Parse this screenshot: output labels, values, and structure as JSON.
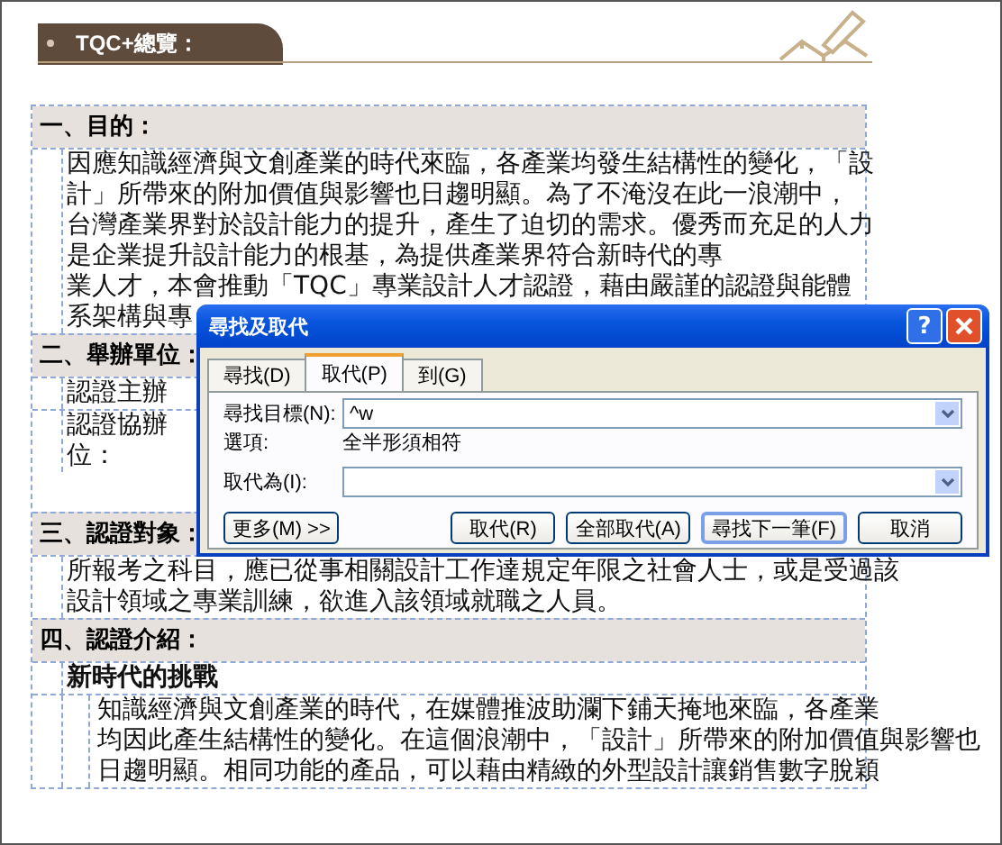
{
  "header": {
    "title": "TQC+總覽："
  },
  "sections": [
    {
      "heading": "一、目的：",
      "rows": [
        {
          "kind": "text",
          "lines": [
            "因應知識經濟與文創產業的時代來臨，各產業均發生結構性的變化，「設",
            "計」所帶來的附加價值與影響也日趨明顯。為了不淹沒在此一浪潮中，",
            "台灣產業界對於設計能力的提升，產生了迫切的需求。優秀而充足的人力",
            "是企業提升設計能力的根基，為提供產業界符合新時代的專",
            "業人才，本會推動「TQC」專業設計人才認證，藉由嚴謹的認證與能體",
            "系架構與專"
          ]
        }
      ]
    },
    {
      "heading": "二、舉辦單位：",
      "rows": [
        {
          "kind": "text",
          "lines": [
            "認證主辦"
          ]
        },
        {
          "kind": "text",
          "lines": [
            "認證協辦",
            "位："
          ]
        }
      ]
    },
    {
      "heading": "三、認證對象：",
      "rows": [
        {
          "kind": "text",
          "lines": [
            "所報考之科目，應已從事相關設計工作達規定年限之社會人士，或是受過該",
            "設計領域之專業訓練，欲進入該領域就職之人員。"
          ]
        }
      ]
    },
    {
      "heading": "四、認證介紹：",
      "rows": [
        {
          "kind": "subheading",
          "lines": [
            "新時代的挑戰"
          ]
        },
        {
          "kind": "nested",
          "lines": [
            "知識經濟與文創產業的時代，在媒體推波助瀾下鋪天掩地來臨，各產業",
            "均因此產生結構性的變化。在這個浪潮中，「設計」所帶來的附加價值與影響也",
            "日趨明顯。相同功能的產品，可以藉由精緻的外型設計讓銷售數字脫穎"
          ]
        }
      ]
    }
  ],
  "dialog": {
    "title": "尋找及取代",
    "help": "?",
    "tabs": [
      {
        "label": "尋找(D)",
        "selected": false
      },
      {
        "label": "取代(P)",
        "selected": true
      },
      {
        "label": "到(G)",
        "selected": false
      }
    ],
    "find": {
      "label": "尋找目標(N):",
      "value": "^w"
    },
    "options": {
      "label": "選項:",
      "value": "全半形須相符"
    },
    "replace": {
      "label": "取代為(I):"
    },
    "buttons": [
      {
        "label": "更多(M) >>",
        "default": false
      },
      {
        "label": "取代(R)",
        "default": false
      },
      {
        "label": "全部取代(A)",
        "default": false
      },
      {
        "label": "尋找下一筆(F)",
        "default": true
      },
      {
        "label": "取消",
        "default": false
      }
    ]
  }
}
